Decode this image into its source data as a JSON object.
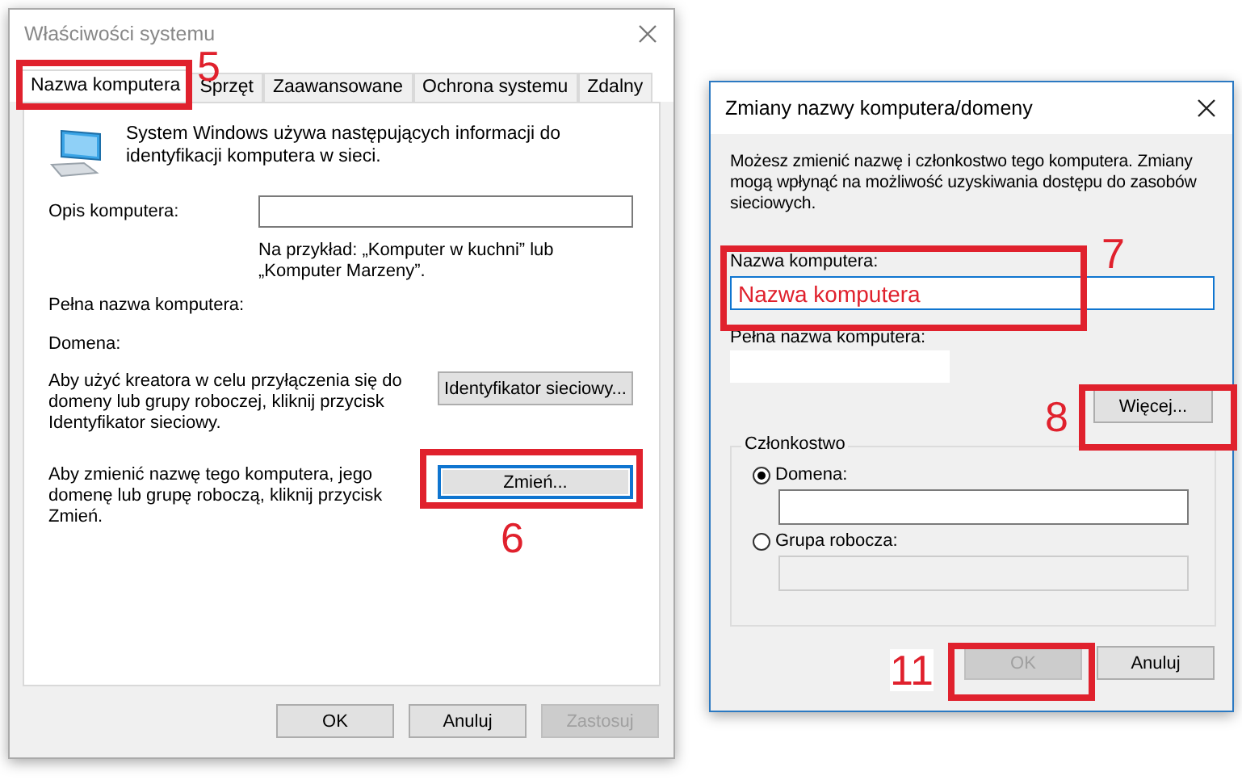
{
  "system_properties": {
    "title": "Właściwości systemu",
    "tabs": [
      {
        "label": "Nazwa komputera",
        "selected": true
      },
      {
        "label": "Sprzęt",
        "selected": false
      },
      {
        "label": "Zaawansowane",
        "selected": false
      },
      {
        "label": "Ochrona systemu",
        "selected": false
      },
      {
        "label": "Zdalny",
        "selected": false
      }
    ],
    "intro": "System Windows używa następujących informacji do identyfikacji komputera w sieci.",
    "description_label": "Opis komputera:",
    "example": "Na przykład: „Komputer w kuchni” lub „Komputer Marzeny”.",
    "full_name_label": "Pełna nazwa komputera:",
    "domain_label": "Domena:",
    "network_id_text": "Aby użyć kreatora w celu przyłączenia się do domeny lub grupy roboczej, kliknij przycisk Identyfikator sieciowy.",
    "network_id_button": "Identyfikator sieciowy...",
    "change_text": "Aby zmienić nazwę tego komputera, jego domenę lub grupę roboczą, kliknij przycisk Zmień.",
    "change_button": "Zmień...",
    "buttons": [
      {
        "label": "OK",
        "disabled": false
      },
      {
        "label": "Anuluj",
        "disabled": false
      },
      {
        "label": "Zastosuj",
        "disabled": true
      }
    ]
  },
  "rename_dialog": {
    "title": "Zmiany nazwy komputera/domeny",
    "intro": "Możesz zmienić nazwę i członkostwo tego komputera. Zmiany mogą wpłynąć na możliwość uzyskiwania dostępu do zasobów sieciowych.",
    "name_label": "Nazwa komputera:",
    "name_value": "Nazwa komputera",
    "full_name_label": "Pełna nazwa komputera:",
    "more_button": "Więcej...",
    "membership": {
      "title": "Członkostwo",
      "options": [
        {
          "label": "Domena:",
          "selected": true,
          "disabled": false
        },
        {
          "label": "Grupa robocza:",
          "selected": false,
          "disabled": true
        }
      ]
    },
    "buttons": [
      {
        "label": "OK",
        "disabled": true
      },
      {
        "label": "Anuluj",
        "disabled": false
      }
    ]
  },
  "annotations": [
    {
      "number": "5"
    },
    {
      "number": "6"
    },
    {
      "number": "7"
    },
    {
      "number": "8"
    },
    {
      "number": "11"
    }
  ]
}
